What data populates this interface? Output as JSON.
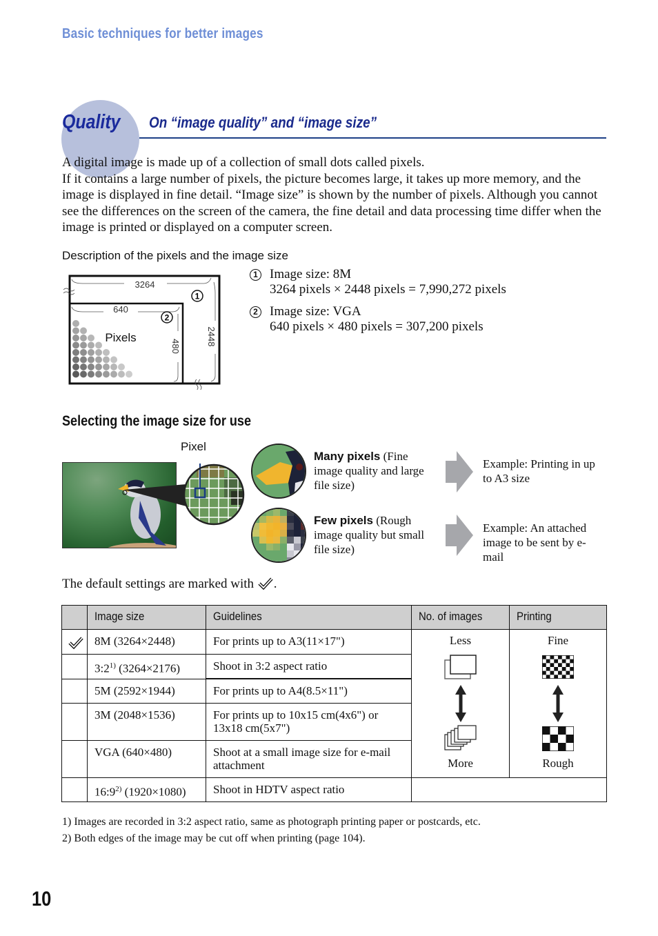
{
  "header": {
    "section": "Basic techniques for better images"
  },
  "section": {
    "badge": "Quality",
    "title": "On “image quality” and “image size”"
  },
  "intro": {
    "paragraphs": [
      "A digital image is made up of a collection of small dots called pixels.",
      "If it contains a large number of pixels, the picture becomes large, it takes up more memory, and the image is displayed in fine detail. “Image size” is shown by the number of pixels. Although you cannot see the differences on the screen of the camera, the fine detail and data processing time differ when the image is printed or displayed on a computer screen."
    ]
  },
  "pixel_diagram": {
    "caption": "Description of the pixels and the image size",
    "outer_width": "3264",
    "outer_height": "2448",
    "inner_width": "640",
    "inner_height": "480",
    "label": "Pixels",
    "marker_1": "1",
    "marker_2": "2",
    "legend": [
      {
        "marker": "1",
        "title": "Image size: 8M",
        "detail": "3264 pixels × 2448 pixels = 7,990,272 pixels"
      },
      {
        "marker": "2",
        "title": "Image size: VGA",
        "detail": "640 pixels × 480 pixels = 307,200 pixels"
      }
    ]
  },
  "selecting": {
    "heading": "Selecting the image size for use",
    "pixel_label": "Pixel",
    "options": [
      {
        "bold": "Many pixels",
        "text": " (Fine image quality and large file size)",
        "example": "Example: Printing in up to A3 size"
      },
      {
        "bold": "Few pixels",
        "text": " (Rough image quality but small file size)",
        "example": "Example: An attached image to be sent by e-mail"
      }
    ]
  },
  "default_note": {
    "text": "The default settings are marked with",
    "suffix": "."
  },
  "table": {
    "headers": [
      "",
      "Image size",
      "Guidelines",
      "No. of images",
      "Printing"
    ],
    "rows": [
      {
        "default": true,
        "size": "8M (3264×2448)",
        "sup": "",
        "size_rest": "",
        "guideline": "For prints up to A3(11×17\")"
      },
      {
        "default": false,
        "size": "3:2",
        "sup": "1)",
        "size_rest": " (3264×2176)",
        "guideline": "Shoot in 3:2 aspect ratio"
      },
      {
        "default": false,
        "size": "5M (2592×1944)",
        "sup": "",
        "size_rest": "",
        "guideline": "For prints up to A4(8.5×11\")"
      },
      {
        "default": false,
        "size": "3M (2048×1536)",
        "sup": "",
        "size_rest": "",
        "guideline": "For prints up to 10x15 cm(4x6\") or 13x18 cm(5x7\")"
      },
      {
        "default": false,
        "size": "VGA (640×480)",
        "sup": "",
        "size_rest": "",
        "guideline": "Shoot at a small image size for e-mail attachment"
      },
      {
        "default": false,
        "size": "16:9",
        "sup": "2)",
        "size_rest": " (1920×1080)",
        "guideline": "Shoot in HDTV aspect ratio"
      }
    ],
    "images_scale": {
      "top": "Less",
      "bottom": "More"
    },
    "printing_scale": {
      "top": "Fine",
      "bottom": "Rough"
    }
  },
  "footnotes": [
    "1) Images are recorded in 3:2 aspect ratio, same as photograph printing paper or postcards, etc.",
    "2) Both edges of the image may be cut off when printing (page 104)."
  ],
  "page_number": "10",
  "colors": {
    "header_blue": "#6f8fd6",
    "title_navy": "#1a2a8c",
    "badge_circle": "#b7c0dc",
    "rule": "#1d3f86",
    "table_header_bg": "#cfcfcf"
  }
}
